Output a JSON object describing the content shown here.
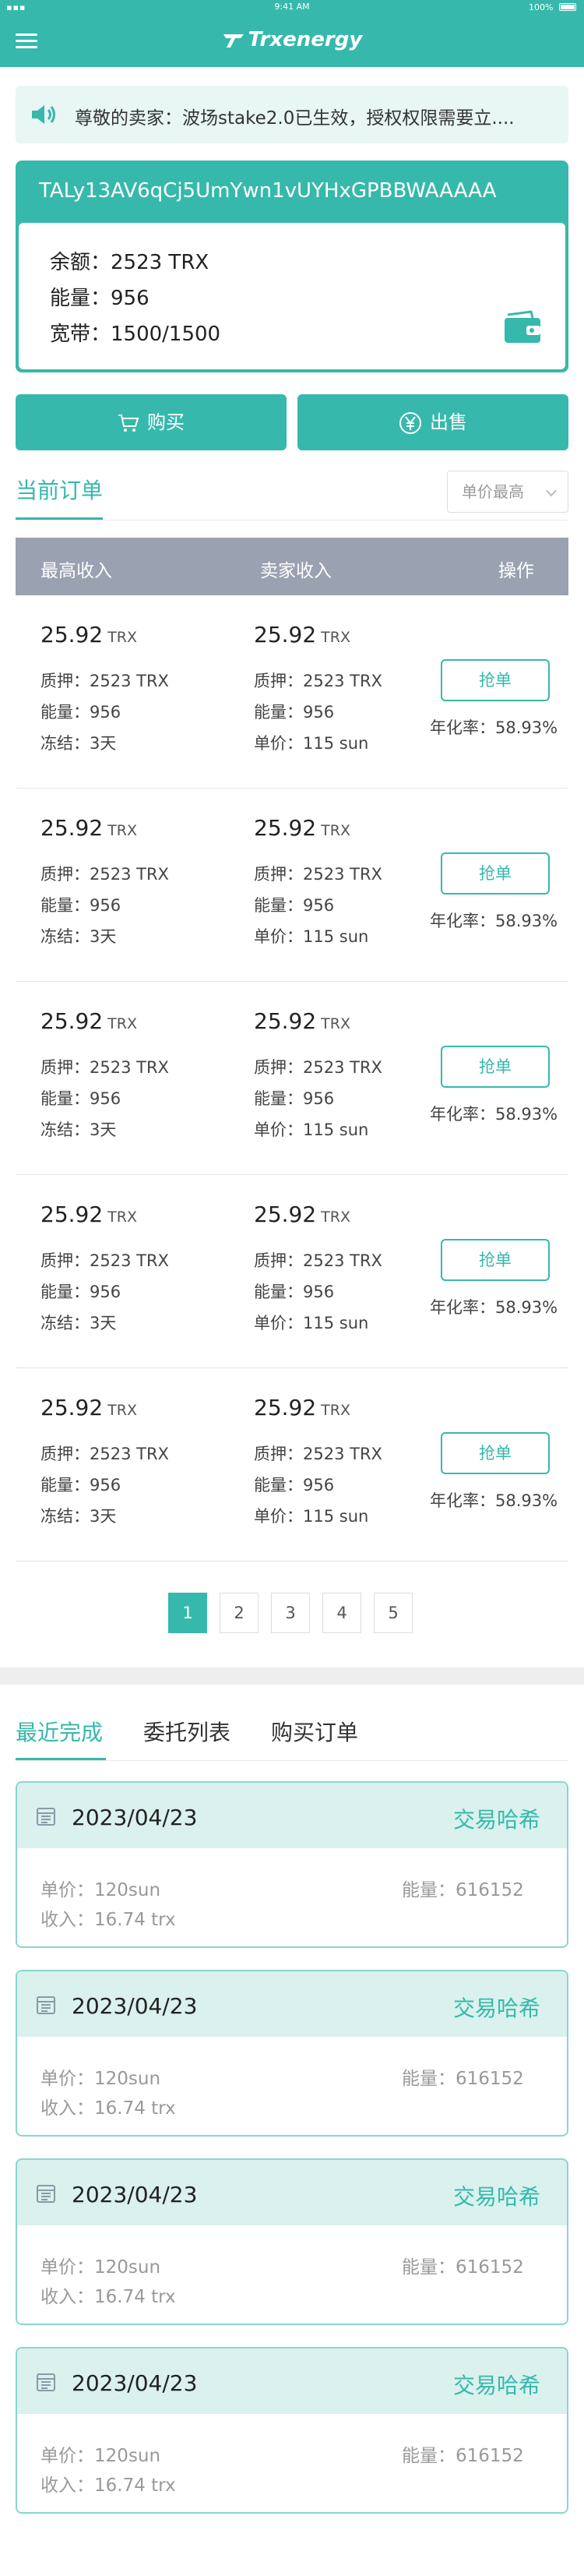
{
  "status_bar": {
    "time": "9:41 AM",
    "battery": "100%"
  },
  "header": {
    "brand": "Trxenergy"
  },
  "notice": {
    "text": "尊敬的卖家：波场stake2.0已生效，授权权限需要立...."
  },
  "account": {
    "address": "TALy13AV6qCj5UmYwn1vUYHxGPBBWAAAAA",
    "balance": "余额：2523 TRX",
    "energy": "能量：956",
    "bandwidth": "宽带：1500/1500"
  },
  "actions": {
    "buy": "购买",
    "sell": "出售"
  },
  "orders": {
    "tab": "当前订单",
    "sort": "单价最高",
    "headers": {
      "max_income": "最高收入",
      "seller_income": "卖家收入",
      "operation": "操作"
    },
    "items": [
      {
        "max_value": "25.92",
        "max_unit": "TRX",
        "seller_value": "25.92",
        "seller_unit": "TRX",
        "pledge": "质押：2523 TRX",
        "energy": "能量：956",
        "freeze": "冻结：3天",
        "seller_pledge": "质押：2523 TRX",
        "seller_energy": "能量：956",
        "price": "单价：115 sun",
        "grab": "抢单",
        "rate": "年化率：58.93%"
      },
      {
        "max_value": "25.92",
        "max_unit": "TRX",
        "seller_value": "25.92",
        "seller_unit": "TRX",
        "pledge": "质押：2523 TRX",
        "energy": "能量：956",
        "freeze": "冻结：3天",
        "seller_pledge": "质押：2523 TRX",
        "seller_energy": "能量：956",
        "price": "单价：115 sun",
        "grab": "抢单",
        "rate": "年化率：58.93%"
      },
      {
        "max_value": "25.92",
        "max_unit": "TRX",
        "seller_value": "25.92",
        "seller_unit": "TRX",
        "pledge": "质押：2523 TRX",
        "energy": "能量：956",
        "freeze": "冻结：3天",
        "seller_pledge": "质押：2523 TRX",
        "seller_energy": "能量：956",
        "price": "单价：115 sun",
        "grab": "抢单",
        "rate": "年化率：58.93%"
      },
      {
        "max_value": "25.92",
        "max_unit": "TRX",
        "seller_value": "25.92",
        "seller_unit": "TRX",
        "pledge": "质押：2523 TRX",
        "energy": "能量：956",
        "freeze": "冻结：3天",
        "seller_pledge": "质押：2523 TRX",
        "seller_energy": "能量：956",
        "price": "单价：115 sun",
        "grab": "抢单",
        "rate": "年化率：58.93%"
      },
      {
        "max_value": "25.92",
        "max_unit": "TRX",
        "seller_value": "25.92",
        "seller_unit": "TRX",
        "pledge": "质押：2523 TRX",
        "energy": "能量：956",
        "freeze": "冻结：3天",
        "seller_pledge": "质押：2523 TRX",
        "seller_energy": "能量：956",
        "price": "单价：115 sun",
        "grab": "抢单",
        "rate": "年化率：58.93%"
      }
    ]
  },
  "pagination": {
    "pages": [
      "1",
      "2",
      "3",
      "4",
      "5"
    ],
    "current": "1"
  },
  "history": {
    "tabs": [
      "最近完成",
      "委托列表",
      "购买订单"
    ],
    "records": [
      {
        "date": "2023/04/23",
        "hash_label": "交易哈希",
        "price": "单价：120sun",
        "energy": "能量：616152",
        "income": "收入：16.74 trx"
      },
      {
        "date": "2023/04/23",
        "hash_label": "交易哈希",
        "price": "单价：120sun",
        "energy": "能量：616152",
        "income": "收入：16.74 trx"
      },
      {
        "date": "2023/04/23",
        "hash_label": "交易哈希",
        "price": "单价：120sun",
        "energy": "能量：616152",
        "income": "收入：16.74 trx"
      },
      {
        "date": "2023/04/23",
        "hash_label": "交易哈希",
        "price": "单价：120sun",
        "energy": "能量：616152",
        "income": "收入：16.74 trx"
      }
    ]
  },
  "colors": {
    "accent": "#36b9ac",
    "table_header": "#9aa1b0",
    "notice_bg": "#e8f6f4"
  },
  "icons": {
    "menu": "hamburger-icon",
    "notice": "speaker-icon",
    "wallet": "wallet-icon",
    "buy": "cart-icon",
    "sell": "yen-icon",
    "record": "calendar-icon"
  }
}
